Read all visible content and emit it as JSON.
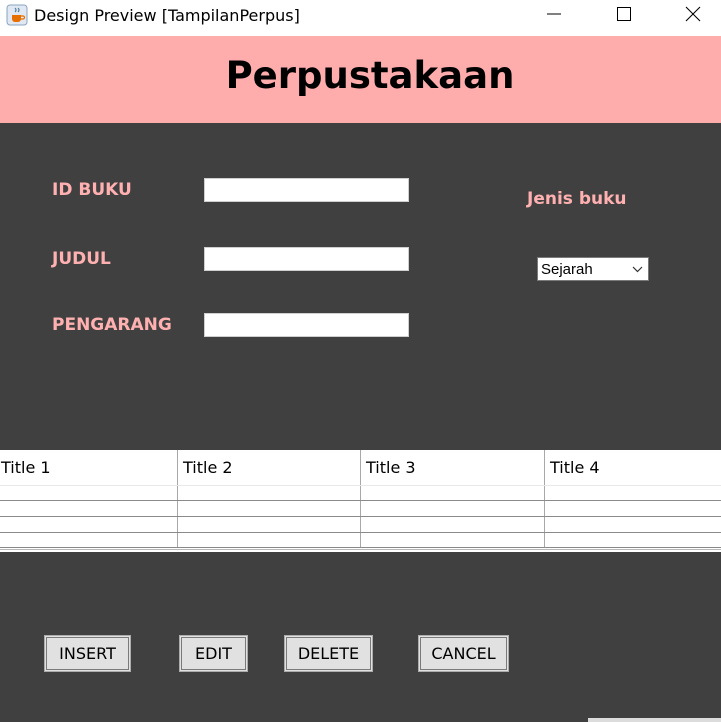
{
  "window": {
    "title": "Design Preview [TampilanPerpus]",
    "icon": "java-cup-icon"
  },
  "header": {
    "title": "Perpustakaan",
    "background": "#ffacac"
  },
  "form": {
    "id_label": "ID BUKU",
    "judul_label": "JUDUL",
    "pengarang_label": "PENGARANG",
    "id_value": "",
    "judul_value": "",
    "pengarang_value": "",
    "jenis_label": "Jenis buku",
    "jenis_selected": "Sejarah",
    "label_color": "#ffb0b0",
    "panel_color": "#404040"
  },
  "table": {
    "columns": [
      "Title 1",
      "Title 2",
      "Title 3",
      "Title 4"
    ],
    "rows": [
      [
        "",
        "",
        "",
        ""
      ],
      [
        "",
        "",
        "",
        ""
      ],
      [
        "",
        "",
        "",
        ""
      ],
      [
        "",
        "",
        "",
        ""
      ]
    ]
  },
  "buttons": {
    "insert": "INSERT",
    "edit": "EDIT",
    "delete": "DELETE",
    "cancel": "CANCEL"
  }
}
